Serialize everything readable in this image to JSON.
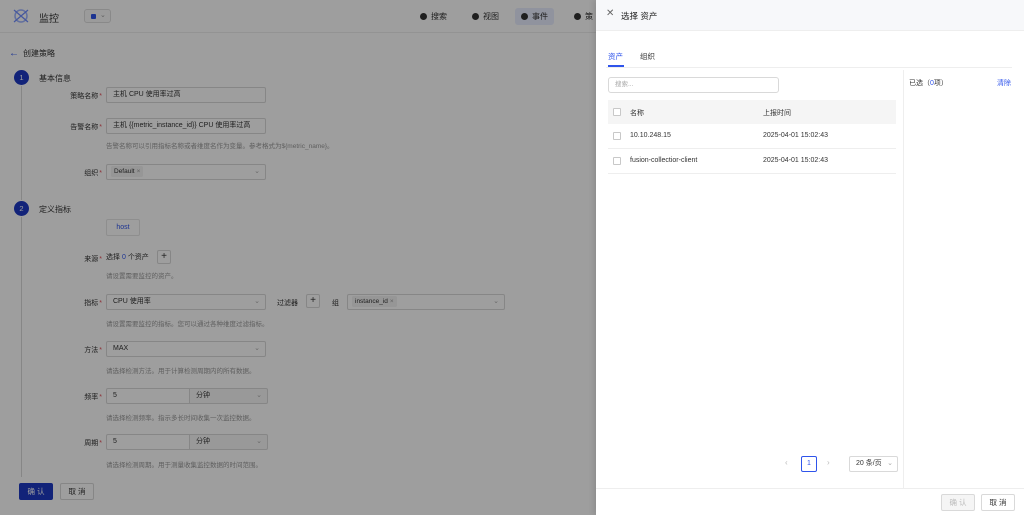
{
  "nav": {
    "brand": "监控",
    "items": [
      {
        "label": "搜索",
        "icon": "search-icon"
      },
      {
        "label": "视图",
        "icon": "pie-chart-icon"
      },
      {
        "label": "事件",
        "icon": "bell-icon"
      },
      {
        "label": "策",
        "icon": "hex-icon"
      }
    ]
  },
  "page": {
    "back_label": "创建策略",
    "step1": {
      "num": "1",
      "title": "基本信息"
    },
    "step2": {
      "num": "2",
      "title": "定义指标"
    },
    "policy_name": {
      "label": "策略名称",
      "value": "主机 CPU 使用率过高"
    },
    "alert_name": {
      "label": "告警名称",
      "value": "主机 {{metric_instance_id}} CPU 使用率过高",
      "hint": "告警名称可以引用指标名称或者维度名作为变量。参考格式为${metric_name}。"
    },
    "org": {
      "label": "组织",
      "tag": "Default"
    },
    "host_tab": "host",
    "source": {
      "label": "来源",
      "prefix": "选择",
      "count": "0",
      "suffix": "个资产",
      "hint": "请设置需要监控的资产。"
    },
    "metric": {
      "label": "指标",
      "value": "CPU 使用率",
      "filter_label": "过滤器",
      "group_label": "组",
      "group_tag": "instance_id",
      "hint": "请设置需要监控的指标。您可以通过各种维度过滤指标。"
    },
    "method": {
      "label": "方法",
      "value": "MAX",
      "hint": "请选择检测方法。用于计算检测周期内的所有数据。"
    },
    "frequency": {
      "label": "频率",
      "value": "5",
      "unit": "分钟",
      "hint": "请选择检测频率。指示多长时间收集一次监控数据。"
    },
    "period": {
      "label": "周期",
      "value": "5",
      "unit": "分钟",
      "hint": "请选择检测周期。用于测量收集监控数据的时间范围。"
    },
    "confirm": "确 认",
    "cancel": "取 消"
  },
  "drawer": {
    "title": "选择 资产",
    "tabs": [
      "资产",
      "组织"
    ],
    "search_placeholder": "搜索...",
    "columns": {
      "name": "名称",
      "report_time": "上报时间"
    },
    "rows": [
      {
        "name": "10.10.248.15",
        "time": "2025-04-01 15:02:43"
      },
      {
        "name": "fusion-collectior-client",
        "time": "2025-04-01 15:02:43"
      }
    ],
    "selected_prefix": "已选（",
    "selected_count": "0",
    "selected_suffix": "项）",
    "clear": "清除",
    "pager": {
      "page": "1",
      "size": "20 条/页"
    },
    "confirm": "确 认",
    "cancel": "取 消"
  },
  "colors": {
    "primary": "#1d39c4",
    "link": "#2f54eb",
    "required": "#e34d59"
  }
}
